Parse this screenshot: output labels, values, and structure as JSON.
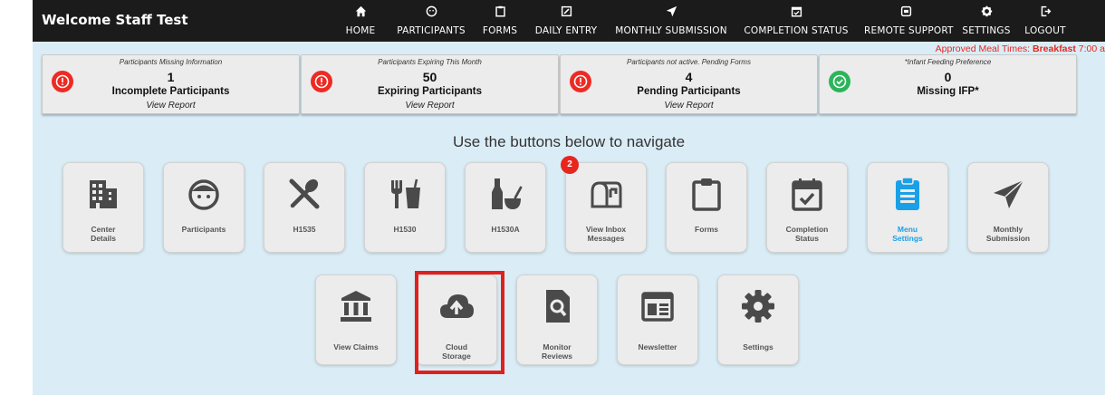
{
  "header": {
    "welcome": "Welcome Staff Test",
    "nav": [
      {
        "label": "HOME",
        "icon": "home-icon"
      },
      {
        "label": "PARTICIPANTS",
        "icon": "smile-icon"
      },
      {
        "label": "FORMS",
        "icon": "clipboard-icon"
      },
      {
        "label": "DAILY ENTRY",
        "icon": "edit-icon"
      },
      {
        "label": "MONTHLY SUBMISSION",
        "icon": "send-icon"
      },
      {
        "label": "COMPLETION STATUS",
        "icon": "calendar-check-icon"
      },
      {
        "label": "REMOTE SUPPORT",
        "icon": "remote-icon"
      },
      {
        "label": "SETTINGS",
        "icon": "gear-icon"
      },
      {
        "label": "LOGOUT",
        "icon": "logout-icon"
      }
    ]
  },
  "ticker": {
    "prefix": "Approved Meal Times: ",
    "meal": "Breakfast",
    "time": " 7:00 a"
  },
  "cards": [
    {
      "caption": "Participants Missing Information",
      "count": "1",
      "label": "Incomplete Participants",
      "link": "View Report",
      "status": "alert",
      "color": "#ee2a23"
    },
    {
      "caption": "Participants Expiring This Month",
      "count": "50",
      "label": "Expiring Participants",
      "link": "View Report",
      "status": "alert",
      "color": "#ee2a23"
    },
    {
      "caption": "Participants not active. Pending Forms",
      "count": "4",
      "label": "Pending Participants",
      "link": "View Report",
      "status": "alert",
      "color": "#ee2a23"
    },
    {
      "caption": "*Infant Feeding Preference",
      "count": "0",
      "label": "Missing IFP*",
      "link": "",
      "status": "ok",
      "color": "#2bb55a"
    }
  ],
  "prompt": "Use the buttons below to navigate",
  "tiles_row1": [
    {
      "label1": "Center",
      "label2": "Details",
      "icon": "building-icon"
    },
    {
      "label1": "Participants",
      "label2": "",
      "icon": "child-face-icon"
    },
    {
      "label1": "H1535",
      "label2": "",
      "icon": "utensils-icon"
    },
    {
      "label1": "H1530",
      "label2": "",
      "icon": "fork-cup-icon"
    },
    {
      "label1": "H1530A",
      "label2": "",
      "icon": "bottle-bowl-icon"
    },
    {
      "label1": "View Inbox",
      "label2": "Messages",
      "icon": "mailbox-icon",
      "badge": "2"
    },
    {
      "label1": "Forms",
      "label2": "",
      "icon": "clipboard-icon"
    },
    {
      "label1": "Completion",
      "label2": "Status",
      "icon": "calendar-check-icon"
    },
    {
      "label1": "Menu",
      "label2": "Settings",
      "icon": "menu-clipboard-icon",
      "active": true
    },
    {
      "label1": "Monthly",
      "label2": "Submission",
      "icon": "paper-plane-icon"
    }
  ],
  "tiles_row2": [
    {
      "label1": "View Claims",
      "label2": "",
      "icon": "bank-icon"
    },
    {
      "label1": "Cloud",
      "label2": "Storage",
      "icon": "cloud-upload-icon"
    },
    {
      "label1": "Monitor",
      "label2": "Reviews",
      "icon": "file-search-icon"
    },
    {
      "label1": "Newsletter",
      "label2": "",
      "icon": "newspaper-icon"
    },
    {
      "label1": "Settings",
      "label2": "",
      "icon": "gear-icon"
    }
  ],
  "colors": {
    "topbar": "#1b1b1b",
    "panel": "#daedf6",
    "accent": "#1aa0e6",
    "alert": "#ee2a23",
    "ok": "#2bb55a",
    "highlight": "#e0201e"
  }
}
